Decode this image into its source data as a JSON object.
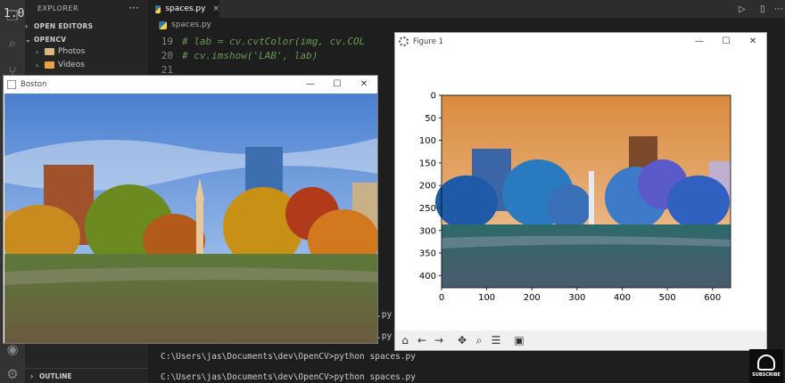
{
  "overlay": {
    "zoom_label": "1.00"
  },
  "sidebar": {
    "title": "EXPLORER",
    "more": "···",
    "open_editors": "OPEN EDITORS",
    "folder": "OPENCV",
    "items": [
      {
        "label": "Photos",
        "color": "#dcb67a"
      },
      {
        "label": "Videos",
        "color": "#e8a33d"
      }
    ],
    "outline": "OUTLINE"
  },
  "editor": {
    "tab_label": "spaces.py",
    "tab_close": "×",
    "breadcrumb": "spaces.py",
    "lines": [
      {
        "num": "19",
        "text": "# lab = cv.cvtColor(img, cv.COL"
      },
      {
        "num": "20",
        "text": "# cv.imshow('LAB', lab)"
      },
      {
        "num": "21",
        "text": ""
      }
    ]
  },
  "terminal": {
    "lines": [
      "C:\\Users\\jas\\Documents\\dev\\OpenCV>python spaces.py",
      "C:\\Users\\jas\\Documents\\dev\\OpenCV>python spaces.py"
    ],
    "fragments": [
      ".py",
      ".py"
    ]
  },
  "boston_window": {
    "title": "Boston",
    "min": "—",
    "max": "☐",
    "close": "✕"
  },
  "figure_window": {
    "title": "Figure 1",
    "min": "—",
    "max": "☐",
    "close": "✕",
    "x_ticks": [
      "0",
      "100",
      "200",
      "300",
      "400",
      "500",
      "600"
    ],
    "y_ticks": [
      "0",
      "50",
      "100",
      "150",
      "200",
      "250",
      "300",
      "350",
      "400"
    ],
    "toolbar": [
      "home-icon",
      "back-icon",
      "forward-icon",
      "pan-icon",
      "zoom-icon",
      "configure-icon",
      "save-icon"
    ]
  },
  "badge": {
    "text": "SUBSCRIBE"
  },
  "colors": {
    "accent_blue": "#0e639c",
    "sky_orange": "#e8a060",
    "sky_blue": "#5a8fd8"
  }
}
